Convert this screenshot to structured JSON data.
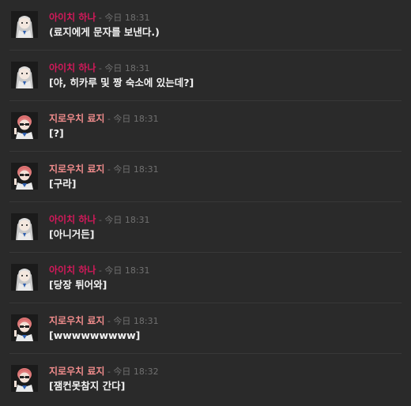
{
  "colors": {
    "background": "#2a2a2a",
    "divider": "#383838",
    "author_hana": "#d2195a",
    "author_ryoji": "#f08c8c",
    "timestamp": "#707070",
    "message_text": "#f2f2f2"
  },
  "messages": [
    {
      "author": "아이치 하나",
      "author_key": "hana",
      "sep": " - ",
      "time": "今日 18:31",
      "text": "(료지에게 문자를 보낸다.)"
    },
    {
      "author": "아이치 하나",
      "author_key": "hana",
      "sep": " - ",
      "time": "今日 18:31",
      "text": "[야, 히카루 및 짱 숙소에 있는데?]"
    },
    {
      "author": "지로우치 료지",
      "author_key": "ryoji",
      "sep": " - ",
      "time": "今日 18:31",
      "text": "[?]"
    },
    {
      "author": "지로우치 료지",
      "author_key": "ryoji",
      "sep": " - ",
      "time": "今日 18:31",
      "text": "[구라]"
    },
    {
      "author": "아이치 하나",
      "author_key": "hana",
      "sep": " - ",
      "time": "今日 18:31",
      "text": "[아니거든]"
    },
    {
      "author": "아이치 하나",
      "author_key": "hana",
      "sep": " - ",
      "time": "今日 18:31",
      "text": "[당장 튀어와]"
    },
    {
      "author": "지로우치 료지",
      "author_key": "ryoji",
      "sep": " - ",
      "time": "今日 18:31",
      "text": "[wwwwwwwww]"
    },
    {
      "author": "지로우치 료지",
      "author_key": "ryoji",
      "sep": " - ",
      "time": "今日 18:32",
      "text": "[잼컨못참지 간다]"
    }
  ],
  "avatars": {
    "hana": "silver-haired-girl-avatar",
    "ryoji": "pink-haired-boy-sunglasses-avatar"
  }
}
